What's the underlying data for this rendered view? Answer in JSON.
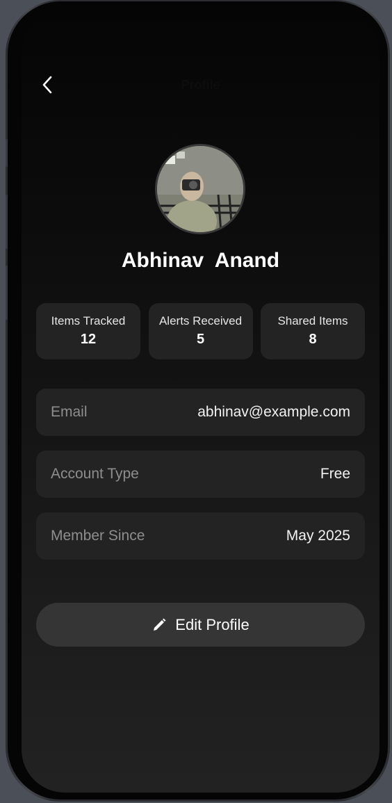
{
  "header": {
    "title": "Profile",
    "back_icon": "chevron-left-icon"
  },
  "profile": {
    "name": "Abhinav  Anand",
    "avatar": "user-photo"
  },
  "stats": [
    {
      "label": "Items Tracked",
      "value": "12"
    },
    {
      "label": "Alerts Received",
      "value": "5"
    },
    {
      "label": "Shared Items",
      "value": "8"
    }
  ],
  "details": [
    {
      "label": "Email",
      "value": "abhinav@example.com"
    },
    {
      "label": "Account Type",
      "value": "Free"
    },
    {
      "label": "Member Since",
      "value": "May 2025"
    }
  ],
  "actions": {
    "edit_label": "Edit Profile",
    "edit_icon": "pencil-icon"
  },
  "colors": {
    "background_top": "#050505",
    "background_bottom": "#222222",
    "card": "#232323",
    "button": "#353535",
    "label_muted": "#8e8e8e",
    "text": "#ffffff"
  }
}
